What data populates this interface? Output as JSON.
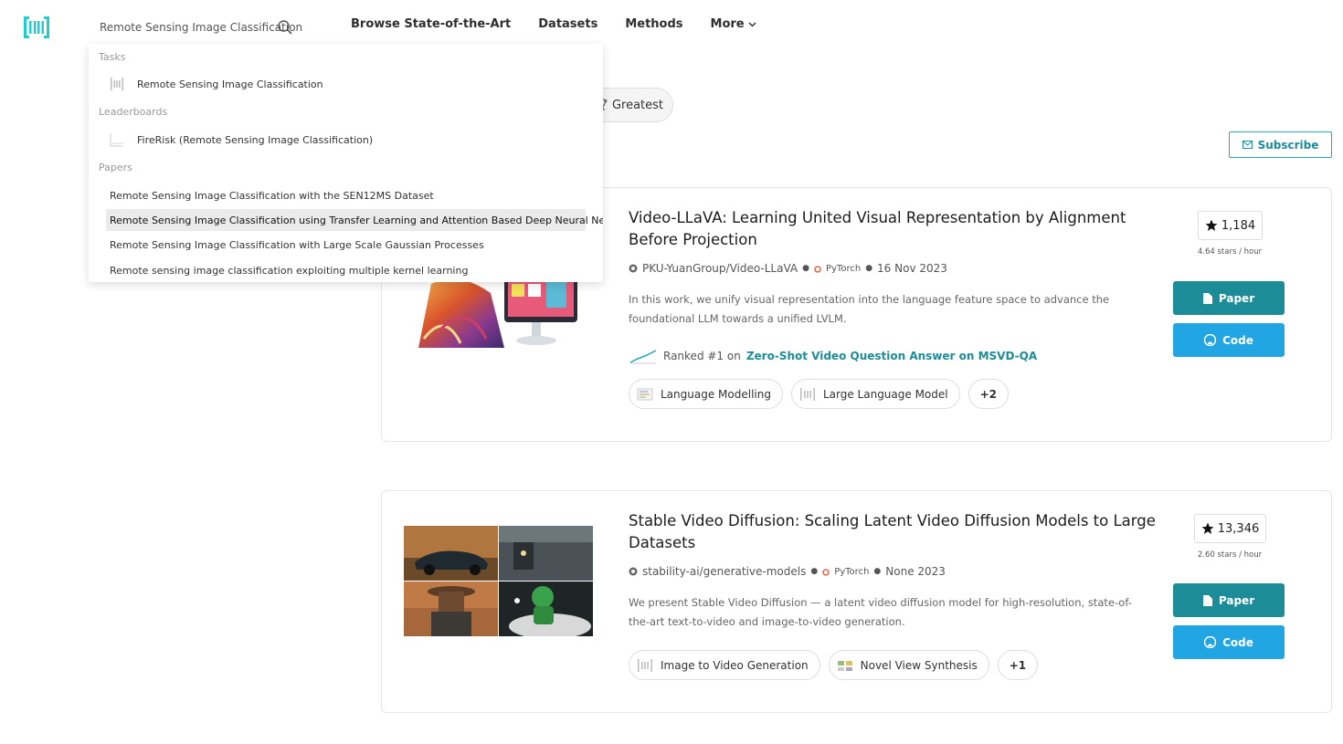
{
  "header": {
    "logo_icon": "paperswithcode-logo-icon",
    "search": {
      "value": "Remote Sensing Image Classification",
      "placeholder": "Search"
    },
    "nav": [
      {
        "label": "Browse State-of-the-Art"
      },
      {
        "label": "Datasets"
      },
      {
        "label": "Methods"
      },
      {
        "label": "More"
      }
    ]
  },
  "filters": {
    "greatest_label": "Greatest"
  },
  "subscribe_label": "Subscribe",
  "dropdown": {
    "tasks_heading": "Tasks",
    "tasks": [
      {
        "label": "Remote Sensing Image Classification",
        "icon": "task-icon"
      }
    ],
    "leaderboards_heading": "Leaderboards",
    "leaderboards": [
      {
        "label": "FireRisk (Remote Sensing Image Classification)",
        "icon": "leaderboard-chart-icon"
      }
    ],
    "papers_heading": "Papers",
    "papers": [
      {
        "label": "Remote Sensing Image Classification with the SEN12MS Dataset"
      },
      {
        "label": "Remote Sensing Image Classification using Transfer Learning and Attention Based Deep Neural Network"
      },
      {
        "label": "Remote Sensing Image Classification with Large Scale Gaussian Processes"
      },
      {
        "label": "Remote sensing image classification exploiting multiple kernel learning"
      }
    ]
  },
  "papers": [
    {
      "title": "Video-LLaVA: Learning United Visual Representation by Alignment Before Projection",
      "repo": "PKU-YuanGroup/Video-LLaVA",
      "framework": "PyTorch",
      "date": "16 Nov 2023",
      "description": "In this work, we unify visual representation into the language feature space to advance the foundational LLM towards a unified LVLM.",
      "ranked_prefix": "Ranked #1 on",
      "ranked_task": "Zero-Shot Video Question Answer on MSVD-QA",
      "tags": [
        {
          "label": "Language Modelling"
        },
        {
          "label": "Large Language Model"
        }
      ],
      "more_tags": "+2",
      "stars": "1,184",
      "stars_rate": "4.64 stars / hour",
      "paper_label": "Paper",
      "code_label": "Code"
    },
    {
      "title": "Stable Video Diffusion: Scaling Latent Video Diffusion Models to Large Datasets",
      "repo": "stability-ai/generative-models",
      "framework": "PyTorch",
      "date": "None 2023",
      "description": "We present Stable Video Diffusion — a latent video diffusion model for high-resolution, state-of-the-art text-to-video and image-to-video generation.",
      "tags": [
        {
          "label": "Image to Video Generation"
        },
        {
          "label": "Novel View Synthesis"
        }
      ],
      "more_tags": "+1",
      "stars": "13,346",
      "stars_rate": "2.60 stars / hour",
      "paper_label": "Paper",
      "code_label": "Code"
    }
  ],
  "colors": {
    "accent": "#1c8c99",
    "code_blue": "#21a5e3",
    "logo": "#21cbce"
  }
}
